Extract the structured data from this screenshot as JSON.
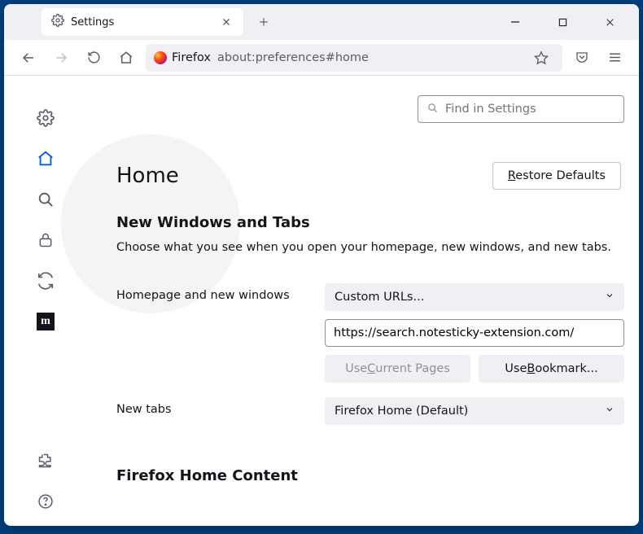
{
  "browser_tab": {
    "title": "Settings"
  },
  "urlbar": {
    "label": "Firefox",
    "path": "about:preferences#home"
  },
  "search": {
    "placeholder": "Find in Settings"
  },
  "page": {
    "title": "Home",
    "restore_label_pre": "R",
    "restore_label_post": "estore Defaults",
    "section1_title": "New Windows and Tabs",
    "section1_desc": "Choose what you see when you open your homepage, new windows, and new tabs.",
    "homepage_label": "Homepage and new windows",
    "homepage_select": "Custom URLs...",
    "homepage_value": "https://search.notesticky-extension.com/",
    "use_current_pre": "Use ",
    "use_current_u": "C",
    "use_current_post": "urrent Pages",
    "use_bookmark_pre": "Use ",
    "use_bookmark_u": "B",
    "use_bookmark_post": "ookmark...",
    "newtabs_label": "New tabs",
    "newtabs_select": "Firefox Home (Default)",
    "section2_title": "Firefox Home Content"
  }
}
